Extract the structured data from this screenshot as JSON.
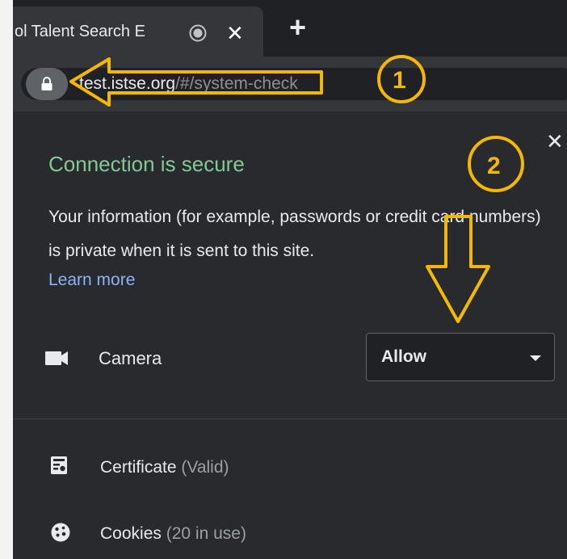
{
  "tab": {
    "title": "ol Talent Search E",
    "close_glyph": "✕"
  },
  "newtab": {
    "glyph": "+"
  },
  "omnibox": {
    "host": "test.istse.org",
    "path": "/#/system-check"
  },
  "popup": {
    "close_glyph": "✕",
    "connection_title": "Connection is secure",
    "info_text": "Your information (for example, passwords or credit card numbers) is private when it is sent to this site.",
    "learn_more": "Learn more",
    "camera": {
      "label": "Camera",
      "value": "Allow"
    },
    "certificate": {
      "label": "Certificate",
      "status": "(Valid)"
    },
    "cookies": {
      "label": "Cookies",
      "status": "(20 in use)"
    }
  },
  "annotations": {
    "step1": "1",
    "step2": "2",
    "color": "#f5b800"
  },
  "colors": {
    "background": "#202124",
    "popup": "#292a2d",
    "secure_green": "#81c995",
    "link_blue": "#8ab4f8"
  }
}
